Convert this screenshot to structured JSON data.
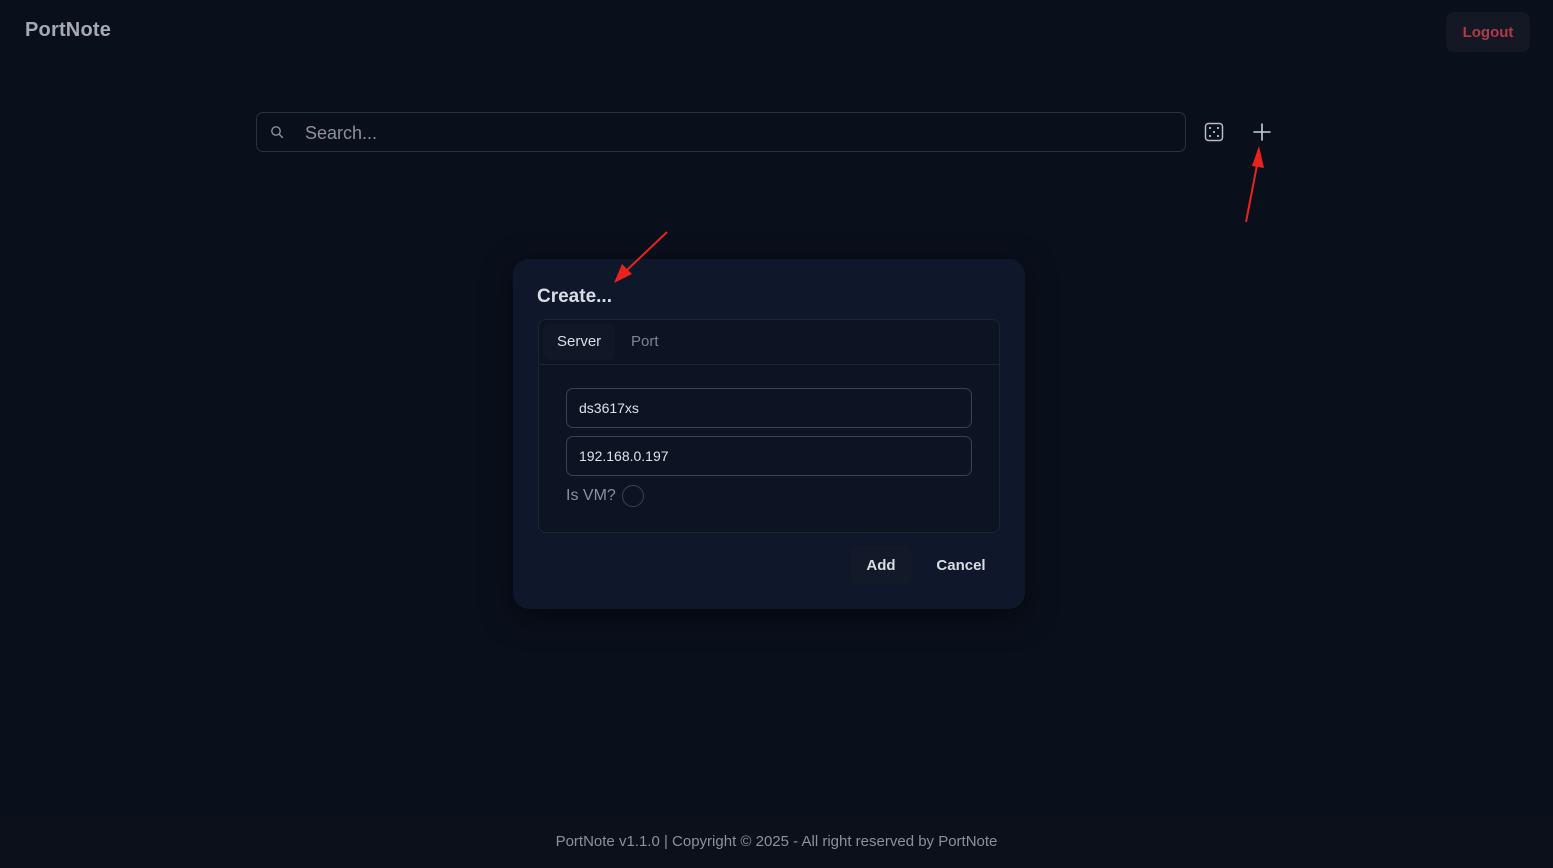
{
  "app": {
    "brand": "PortNote",
    "logout_label": "Logout"
  },
  "search": {
    "placeholder": "Search..."
  },
  "toolbar": {
    "icons": [
      "search-icon",
      "dice-icon",
      "plus-icon"
    ]
  },
  "dialog": {
    "title": "Create...",
    "tabs": [
      {
        "label": "Server",
        "active": true
      },
      {
        "label": "Port",
        "active": false
      }
    ],
    "fields": {
      "server_name": "ds3617xs",
      "ip_address": "192.168.0.197"
    },
    "vm_label": "Is VM?",
    "vm_checked": false,
    "add_label": "Add",
    "cancel_label": "Cancel"
  },
  "footer": {
    "text": "PortNote v1.1.0 | Copyright © 2025 - All right reserved by PortNote"
  },
  "colors": {
    "background": "#0a0f1c",
    "dialog_background": "#0f172a",
    "logout_text": "#b03a47",
    "annotation_arrow": "#e8231c"
  }
}
